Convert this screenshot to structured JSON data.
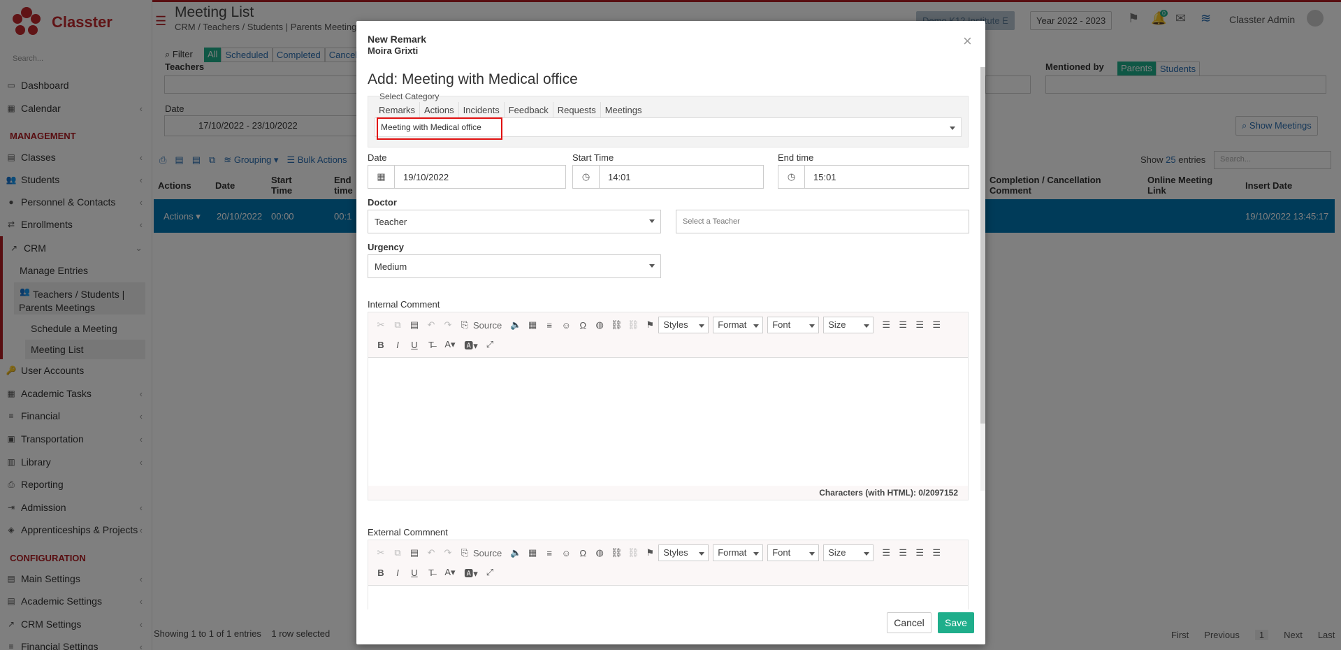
{
  "app": {
    "name": "Classter",
    "search_placeholder": "Search..."
  },
  "sidebar": {
    "items": [
      {
        "label": "Dashboard",
        "icon": "dashboard-icon"
      },
      {
        "label": "Calendar",
        "icon": "calendar-icon"
      },
      {
        "label": "MANAGEMENT"
      },
      {
        "label": "Classes",
        "icon": "classes-icon"
      },
      {
        "label": "Students",
        "icon": "students-icon"
      },
      {
        "label": "Personnel & Contacts",
        "icon": "personnel-icon"
      },
      {
        "label": "Enrollments",
        "icon": "enrollments-icon"
      },
      {
        "label": "CRM",
        "icon": "crm-icon"
      },
      {
        "label": "Manage Entries"
      },
      {
        "label": "Teachers / Students | Parents Meetings"
      },
      {
        "label": "Schedule a Meeting"
      },
      {
        "label": "Meeting List"
      },
      {
        "label": "User Accounts",
        "icon": "key-icon"
      },
      {
        "label": "Academic Tasks",
        "icon": "tasks-icon"
      },
      {
        "label": "Financial",
        "icon": "financial-icon"
      },
      {
        "label": "Transportation",
        "icon": "bus-icon"
      },
      {
        "label": "Library",
        "icon": "library-icon"
      },
      {
        "label": "Reporting",
        "icon": "printer-icon"
      },
      {
        "label": "Admission",
        "icon": "admission-icon"
      },
      {
        "label": "Apprenticeships & Projects",
        "icon": "box-icon"
      },
      {
        "label": "CONFIGURATION"
      },
      {
        "label": "Main Settings",
        "icon": "settings-icon"
      },
      {
        "label": "Academic Settings",
        "icon": "settings-icon"
      },
      {
        "label": "CRM Settings",
        "icon": "crm-icon"
      },
      {
        "label": "Financial Settings",
        "icon": "financial-icon"
      }
    ]
  },
  "header": {
    "title": "Meeting List",
    "breadcrumb": "CRM / Teachers / Students | Parents Meetings",
    "institute": "Demo K12 Institute E",
    "year": "Year 2022 - 2023",
    "user": "Classter Admin",
    "badge_bell": "0"
  },
  "filters": {
    "filter_label": "Filter",
    "tabs": [
      "All",
      "Scheduled",
      "Completed",
      "Cancelled"
    ],
    "teachers_label": "Teachers",
    "date_label": "Date",
    "date_value": "17/10/2022 - 23/10/2022",
    "mentioned_by": "Mentioned by",
    "mentioned_opts": [
      "Parents",
      "Students"
    ],
    "show_meetings": "Show Meetings"
  },
  "table": {
    "toolbar": {
      "grouping": "Grouping",
      "bulk": "Bulk Actions",
      "show": "Show",
      "entries_count": "25",
      "entries": "entries",
      "search_placeholder": "Search..."
    },
    "columns": [
      "Actions",
      "Date",
      "Start Time",
      "End time",
      "Completion / Cancellation Comment",
      "Online Meeting Link",
      "Insert Date"
    ],
    "row": {
      "actions": "Actions",
      "date": "20/10/2022",
      "start": "00:00",
      "end": "00:1",
      "insert": "19/10/2022 13:45:17"
    },
    "footer": {
      "showing": "Showing 1 to 1 of 1 entries",
      "selected": "1 row selected",
      "pager": [
        "First",
        "Previous",
        "1",
        "Next",
        "Last"
      ]
    }
  },
  "modal": {
    "title": "New Remark",
    "subtitle": "Moira Grixti",
    "heading": "Add: Meeting with Medical office",
    "select_category": "Select Category",
    "category_tabs": [
      "Remarks",
      "Actions",
      "Incidents",
      "Feedback",
      "Requests",
      "Meetings"
    ],
    "category_value": "Meeting with Medical office",
    "date_label": "Date",
    "date_value": "19/10/2022",
    "start_label": "Start Time",
    "start_value": "14:01",
    "end_label": "End time",
    "end_value": "15:01",
    "doctor_label": "Doctor",
    "doctor_value": "Teacher",
    "teacher_placeholder": "Select a Teacher",
    "urgency_label": "Urgency",
    "urgency_value": "Medium",
    "internal_label": "Internal Comment",
    "external_label": "External Commnent",
    "toolbar": {
      "source": "Source",
      "styles": "Styles",
      "format": "Format",
      "font": "Font",
      "size": "Size"
    },
    "char_count": "Characters (with HTML): 0/2097152",
    "cancel": "Cancel",
    "save": "Save",
    "colors": {
      "save": "#1fae8b",
      "highlight": "#e01010"
    }
  }
}
